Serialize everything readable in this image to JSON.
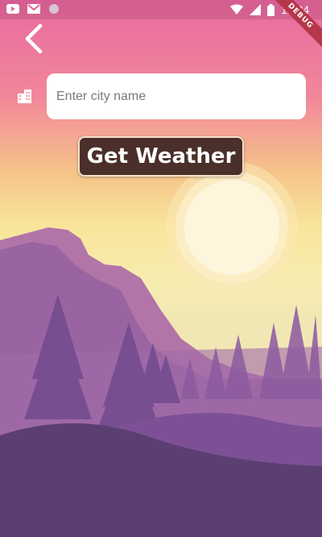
{
  "status_bar": {
    "time": "12:24",
    "debug_label": "DEBUG",
    "icons": [
      "youtube-icon",
      "gmail-icon",
      "circle-notification-icon",
      "wifi-icon",
      "signal-icon",
      "battery-icon"
    ]
  },
  "header": {
    "back_icon": "chevron-left-icon"
  },
  "search": {
    "icon": "city-icon",
    "placeholder": "Enter city name",
    "value": ""
  },
  "action": {
    "button_label": "Get Weather"
  },
  "colors": {
    "button_bg": "#4a2f2a",
    "sky_top": "#e96aa0",
    "sky_mid": "#f6c389",
    "sun": "#fdf6dc",
    "mountain": "#8e5a99",
    "foreground": "#5b3f72"
  }
}
